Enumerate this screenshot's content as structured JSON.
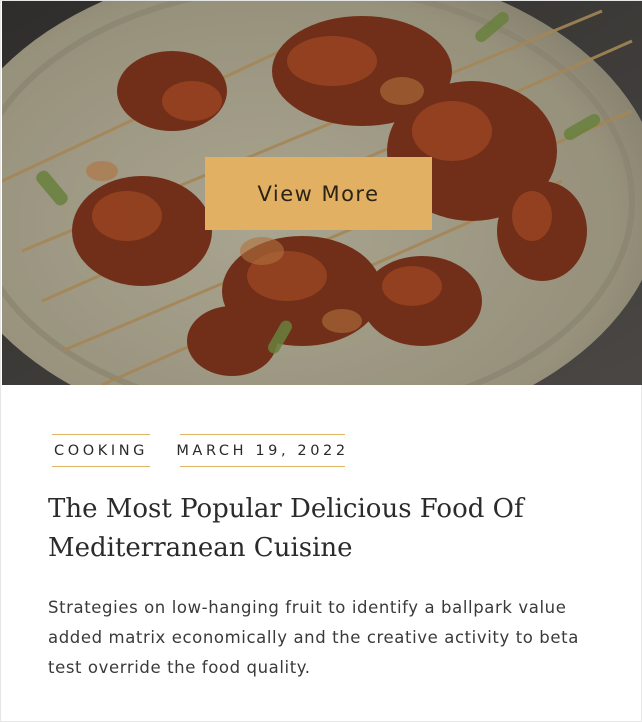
{
  "post": {
    "view_more_label": "View More",
    "category": "COOKING",
    "date": "MARCH 19, 2022",
    "title": "The Most Popular Delicious Food Of Mediterranean Cuisine",
    "excerpt": "Strategies on low-hanging fruit to identify a ballpark value added matrix economically and the creative activity to beta test override the food quality."
  },
  "colors": {
    "accent": "#e2b062",
    "title_text": "#2b2b2b",
    "body_text": "#3a3a3a",
    "border": "#e6e6e6"
  }
}
